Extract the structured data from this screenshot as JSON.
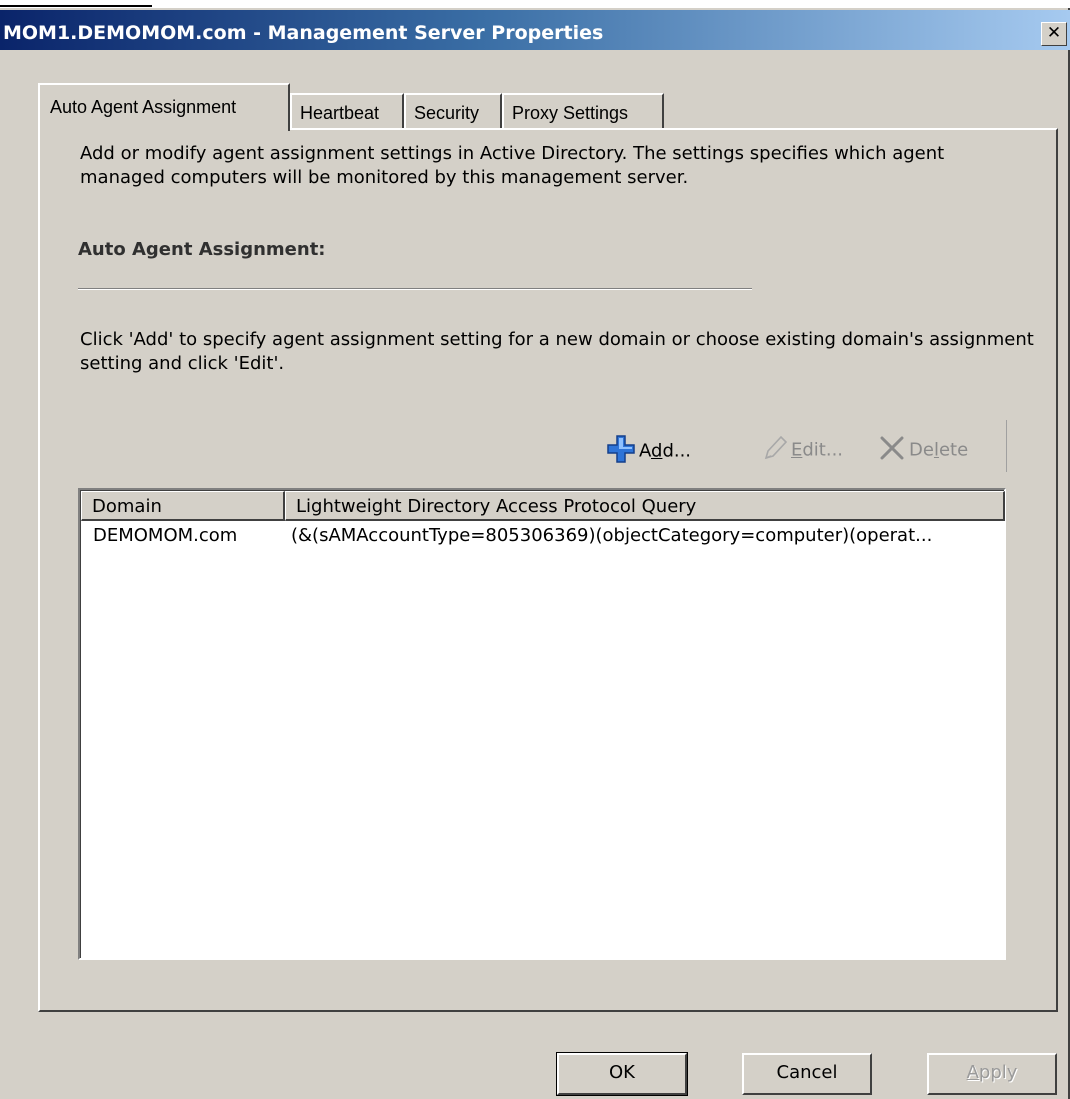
{
  "window": {
    "title": "MOM1.DEMOMOM.com - Management Server Properties",
    "close_glyph": "✕"
  },
  "tabs": [
    {
      "label": "Auto Agent Assignment",
      "active": true
    },
    {
      "label": "Heartbeat",
      "active": false
    },
    {
      "label": "Security",
      "active": false
    },
    {
      "label": "Proxy Settings",
      "active": false
    }
  ],
  "panel": {
    "description": "Add or modify agent assignment settings in Active Directory. The settings specifies which agent managed computers will be monitored by this management server.",
    "section_label": "Auto Agent Assignment:",
    "instructions": "Click 'Add' to specify agent assignment setting for a new domain or choose existing domain's assignment setting and click 'Edit'."
  },
  "toolbar": {
    "add": {
      "pre": "A",
      "accel": "d",
      "post": "d...",
      "icon": "plus-icon",
      "enabled": true
    },
    "edit": {
      "pre": "",
      "accel": "E",
      "post": "dit...",
      "icon": "pencil-icon",
      "enabled": false
    },
    "delete": {
      "pre": "De",
      "accel": "l",
      "post": "ete",
      "icon": "x-icon",
      "enabled": false
    }
  },
  "list": {
    "columns": [
      "Domain",
      "Lightweight Directory Access Protocol Query"
    ],
    "rows": [
      {
        "domain": "DEMOMOM.com",
        "query": "(&(sAMAccountType=805306369)(objectCategory=computer)(operat..."
      }
    ]
  },
  "buttons": {
    "ok": "OK",
    "cancel": "Cancel",
    "apply": {
      "accel": "A",
      "rest": "pply",
      "enabled": false
    }
  },
  "colors": {
    "title_gradient_start": "#0a246a",
    "title_gradient_end": "#a6caf0",
    "face": "#d4d0c8",
    "add_icon": "#2e74d8"
  }
}
